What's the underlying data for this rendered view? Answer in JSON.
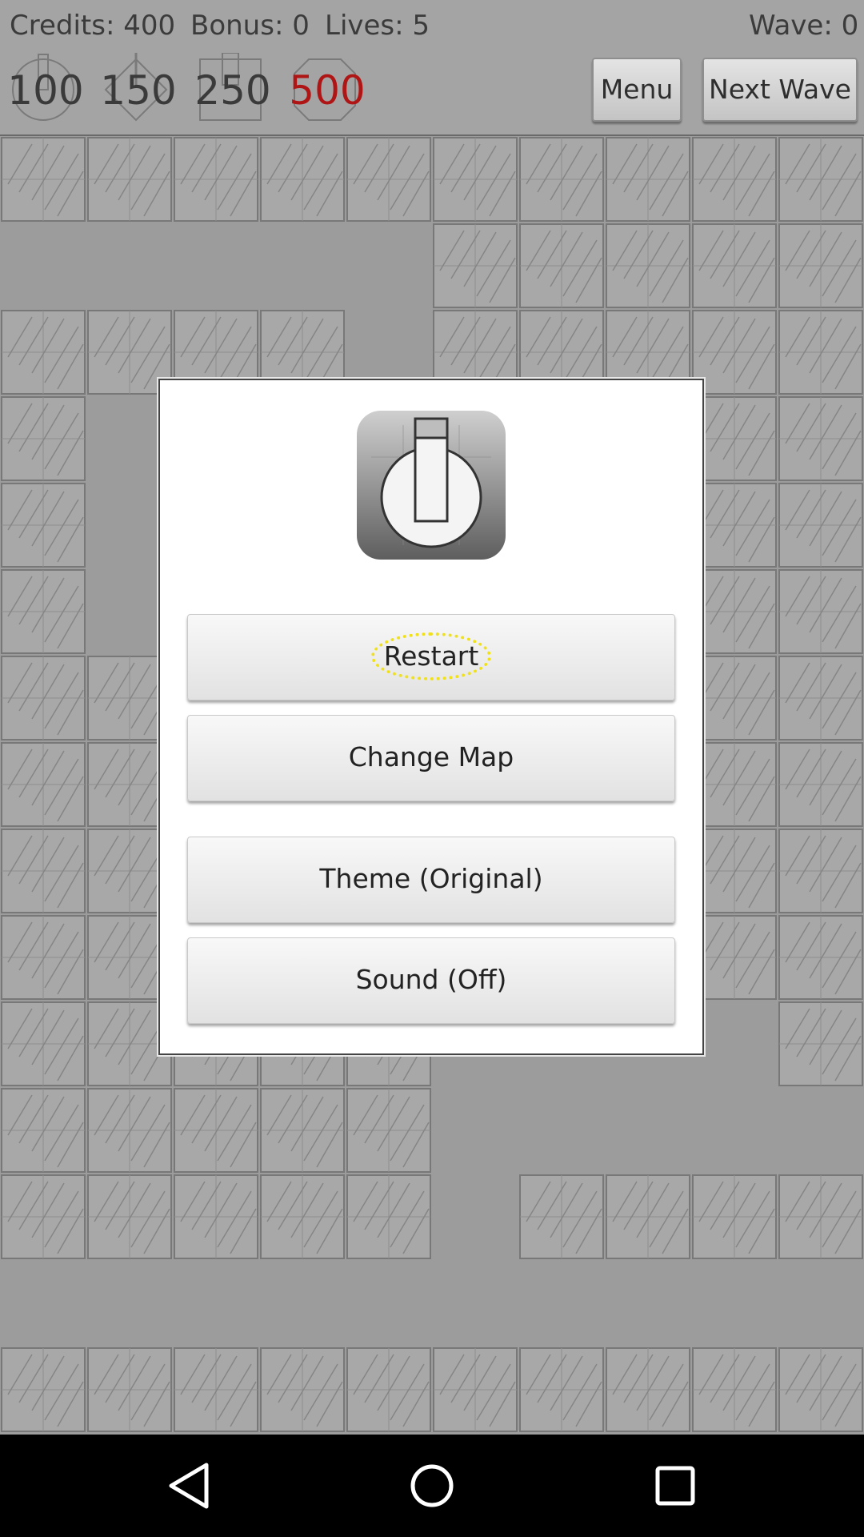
{
  "hud": {
    "credits": "Credits: 400",
    "bonus": "Bonus: 0",
    "lives": "Lives: 5",
    "wave": "Wave: 0",
    "towers": [
      {
        "cost": "100",
        "icon": "gun-tower-icon"
      },
      {
        "cost": "150",
        "icon": "diamond-tower-icon"
      },
      {
        "cost": "250",
        "icon": "cannon-tower-icon"
      },
      {
        "cost": "500",
        "icon": "round-tower-icon",
        "affordable": false
      }
    ],
    "menu_label": "Menu",
    "next_wave_label": "Next Wave"
  },
  "dialog": {
    "icon": "tower-power-icon",
    "buttons": {
      "restart": "Restart",
      "change_map": "Change Map",
      "theme": "Theme (Original)",
      "sound": "Sound (Off)"
    }
  },
  "navbar": {
    "back": "back-icon",
    "home": "home-icon",
    "recents": "recents-icon"
  },
  "colors": {
    "unaffordable_cost": "#b01515",
    "focus_ring": "#f0e11a"
  }
}
